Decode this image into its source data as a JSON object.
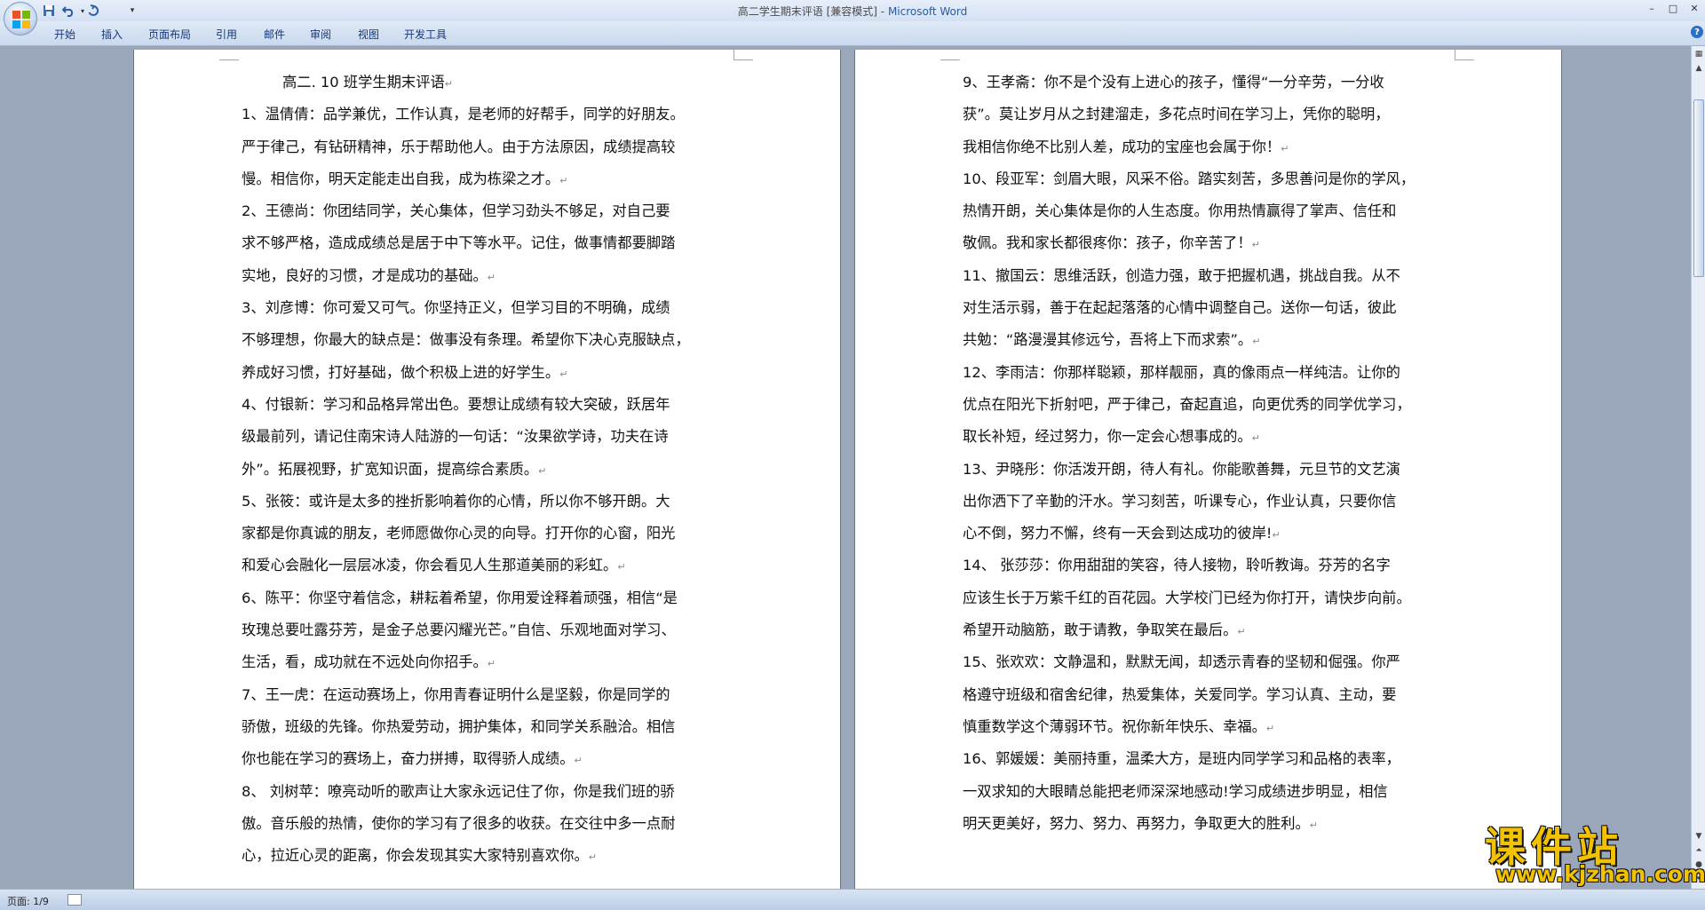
{
  "window": {
    "title": "高二学生期末评语 [兼容模式]",
    "title_sep": " - ",
    "app_name": "Microsoft Word",
    "controls": [
      "–",
      "□",
      "✕"
    ]
  },
  "quick_access": {
    "save_icon": "save-icon",
    "undo_icon": "undo-icon",
    "redo_icon": "redo-icon",
    "customize_icon": "dropdown-icon"
  },
  "ribbon": {
    "tabs": [
      "开始",
      "插入",
      "页面布局",
      "引用",
      "邮件",
      "审阅",
      "视图",
      "开发工具"
    ]
  },
  "document": {
    "title": "高二. 10 班学生期末评语",
    "left_column": [
      [
        "1、温倩倩：品学兼优，工作认真，是老师的好帮手，同学的好朋友。",
        "严于律己，有钻研精神，乐于帮助他人。由于方法原因，成绩提高较",
        "慢。相信你，明天定能走出自我，成为栋梁之才。"
      ],
      [
        "2、王德尚：你团结同学，关心集体，但学习劲头不够足，对自己要",
        "求不够严格，造成成绩总是居于中下等水平。记住，做事情都要脚踏",
        "实地，良好的习惯，才是成功的基础。"
      ],
      [
        "3、刘彦博：你可爱又可气。你坚持正义，但学习目的不明确，成绩",
        "不够理想，你最大的缺点是：做事没有条理。希望你下决心克服缺点，",
        "养成好习惯，打好基础，做个积极上进的好学生。"
      ],
      [
        "4、付银新：学习和品格异常出色。要想让成绩有较大突破，跃居年",
        "级最前列，请记住南宋诗人陆游的一句话：“汝果欲学诗，功夫在诗",
        "外”。拓展视野，扩宽知识面，提高综合素质。"
      ],
      [
        "5、张筱：或许是太多的挫折影响着你的心情，所以你不够开朗。大",
        "家都是你真诚的朋友，老师愿做你心灵的向导。打开你的心窗，阳光",
        "和爱心会融化一层层冰凌，你会看见人生那道美丽的彩虹。"
      ],
      [
        "6、陈平：你坚守着信念，耕耘着希望，你用爱诠释着顽强，相信“是",
        "玫瑰总要吐露芬芳，是金子总要闪耀光芒。”自信、乐观地面对学习、",
        "生活，看，成功就在不远处向你招手。"
      ],
      [
        "7、王一虎：在运动赛场上，你用青春证明什么是坚毅，你是同学的",
        "骄傲，班级的先锋。你热爱劳动，拥护集体，和同学关系融洽。相信",
        "你也能在学习的赛场上，奋力拼搏，取得骄人成绩。"
      ],
      [
        "8、 刘树苹：嘹亮动听的歌声让大家永远记住了你，你是我们班的骄",
        "傲。音乐般的热情，使你的学习有了很多的收获。在交往中多一点耐",
        "心，拉近心灵的距离，你会发现其实大家特别喜欢你。"
      ]
    ],
    "right_column": [
      [
        "9、王孝斋：你不是个没有上进心的孩子，懂得“一分辛劳，一分收",
        "获”。莫让岁月从之封建溜走，多花点时间在学习上，凭你的聪明，",
        "我相信你绝不比别人差，成功的宝座也会属于你！"
      ],
      [
        "10、段亚军：剑眉大眼，风采不俗。踏实刻苦，多思善问是你的学风，",
        "热情开朗，关心集体是你的人生态度。你用热情赢得了掌声、信任和",
        "敬佩。我和家长都很疼你：孩子，你辛苦了！"
      ],
      [
        "11、撤国云：思维活跃，创造力强，敢于把握机遇，挑战自我。从不",
        "对生活示弱，善于在起起落落的心情中调整自己。送你一句话，彼此",
        "共勉：“路漫漫其修远兮，吾将上下而求索”。"
      ],
      [
        "12、李雨洁：你那样聪颖，那样靓丽，真的像雨点一样纯洁。让你的",
        "优点在阳光下折射吧，严于律己，奋起直追，向更优秀的同学优学习，",
        "取长补短，经过努力，你一定会心想事成的。"
      ],
      [
        "13、尹晓彤：你活泼开朗，待人有礼。你能歌善舞，元旦节的文艺演",
        "出你洒下了辛勤的汗水。学习刻苦，听课专心，作业认真，只要你信",
        "心不倒，努力不懈，终有一天会到达成功的彼岸!"
      ],
      [
        "14、 张莎莎：你用甜甜的笑容，待人接物，聆听教诲。芬芳的名字",
        "应该生长于万紫千红的百花园。大学校门已经为你打开，请快步向前。",
        "希望开动脑筋，敢于请教，争取笑在最后。"
      ],
      [
        "15、张欢欢：文静温和，默默无闻，却透示青春的坚韧和倔强。你严",
        "格遵守班级和宿舍纪律，热爱集体，关爱同学。学习认真、主动，要",
        "慎重数学这个薄弱环节。祝你新年快乐、幸福。"
      ],
      [
        "16、郭媛媛：美丽持重，温柔大方，是班内同学学习和品格的表率，",
        "一双求知的大眼睛总能把老师深深地感动!学习成绩进步明显，相信",
        "明天更美好，努力、努力、再努力，争取更大的胜利。"
      ]
    ],
    "paragraph_mark": "↵"
  },
  "status_bar": {
    "page_label": "页面: 1/9"
  },
  "watermark": {
    "title": "课件站",
    "url": "www.kjzhan.com"
  },
  "colors": {
    "workspace": "#9aa7ba",
    "ribbon": "#c9d9ee",
    "accent": "#2c5aa0",
    "watermark": "#f2c200"
  }
}
